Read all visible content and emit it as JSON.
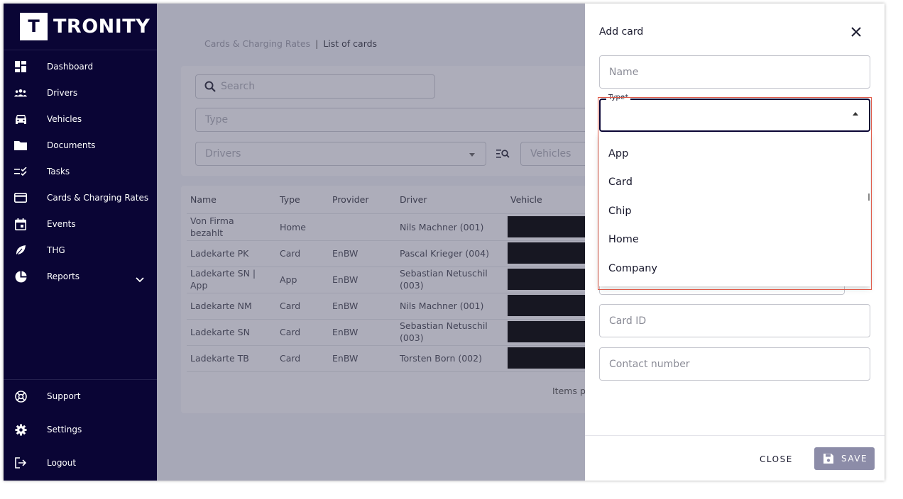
{
  "brand": {
    "logo_letter": "T",
    "name": "TRONITY"
  },
  "sidebar": {
    "items": [
      {
        "label": "Dashboard",
        "icon": "dashboard-icon"
      },
      {
        "label": "Drivers",
        "icon": "people-icon"
      },
      {
        "label": "Vehicles",
        "icon": "car-icon"
      },
      {
        "label": "Documents",
        "icon": "folder-icon"
      },
      {
        "label": "Tasks",
        "icon": "tasks-icon"
      },
      {
        "label": "Cards & Charging Rates",
        "icon": "credit-card-icon"
      },
      {
        "label": "Events",
        "icon": "calendar-icon"
      },
      {
        "label": "THG",
        "icon": "leaf-icon"
      },
      {
        "label": "Reports",
        "icon": "pie-chart-icon"
      }
    ],
    "bottom": [
      {
        "label": "Support",
        "icon": "support-icon"
      },
      {
        "label": "Settings",
        "icon": "gear-icon"
      },
      {
        "label": "Logout",
        "icon": "logout-icon"
      }
    ]
  },
  "breadcrumb": {
    "parent": "Cards & Charging Rates",
    "separator": "|",
    "current": "List of cards"
  },
  "filters": {
    "search_placeholder": "Search",
    "type_placeholder": "Type",
    "drivers_placeholder": "Drivers",
    "vehicles_placeholder": "Vehicles"
  },
  "table": {
    "headers": [
      "Name",
      "Type",
      "Provider",
      "Driver",
      "Vehicle"
    ],
    "rows": [
      {
        "name": "Von Firma bezahlt",
        "type": "Home",
        "provider": "",
        "driver": "Nils Machner (001)"
      },
      {
        "name": "Ladekarte PK",
        "type": "Card",
        "provider": "EnBW",
        "driver": "Pascal Krieger (004)"
      },
      {
        "name": "Ladekarte SN | App",
        "type": "App",
        "provider": "EnBW",
        "driver": "Sebastian Netuschil (003)"
      },
      {
        "name": "Ladekarte NM",
        "type": "Card",
        "provider": "EnBW",
        "driver": "Nils Machner (001)"
      },
      {
        "name": "Ladekarte SN",
        "type": "Card",
        "provider": "EnBW",
        "driver": "Sebastian Netuschil (003)"
      },
      {
        "name": "Ladekarte TB",
        "type": "Card",
        "provider": "EnBW",
        "driver": "Torsten Born (002)"
      }
    ],
    "items_per_page_label": "Items p"
  },
  "drawer": {
    "title": "Add card",
    "name_placeholder": "Name",
    "type_label": "Type*",
    "type_options": [
      "App",
      "Card",
      "Chip",
      "Home",
      "Company"
    ],
    "card_id_placeholder": "Card ID",
    "contact_placeholder": "Contact number",
    "close_label": "CLOSE",
    "save_label": "SAVE"
  },
  "colors": {
    "sidebar_bg": "#0a0535",
    "highlight": "#e05a48",
    "save_bg": "#8c8ca8"
  }
}
